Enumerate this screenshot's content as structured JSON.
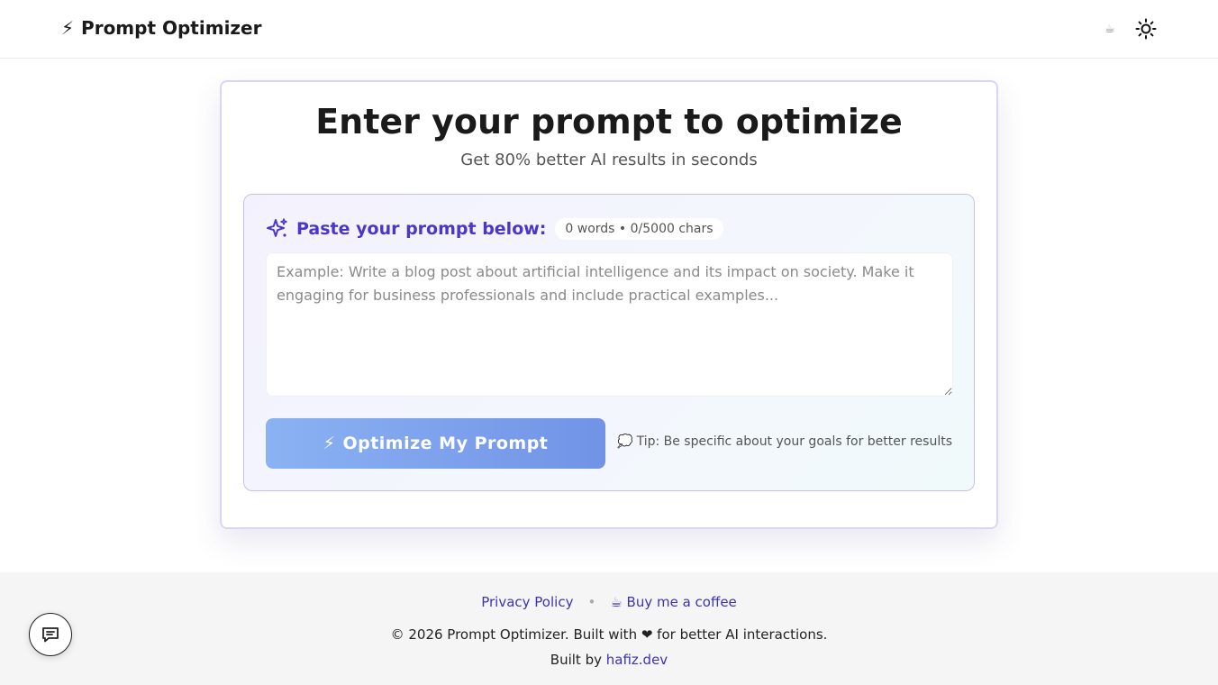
{
  "header": {
    "brand_icon": "⚡",
    "brand_name": "Prompt Optimizer",
    "coffee_icon": "☕",
    "theme_icon": "sun-icon"
  },
  "card": {
    "title": "Enter your prompt to optimize",
    "subtitle": "Get 80% better AI results in seconds",
    "panel_label": "Paste your prompt below:",
    "counter": "0 words • 0/5000 chars",
    "prompt_value": "",
    "prompt_placeholder": "Example: Write a blog post about artificial intelligence and its impact on society. Make it engaging for business professionals and include practical examples...",
    "optimize_icon": "⚡",
    "optimize_label": "Optimize My Prompt",
    "tip_icon": "💭",
    "tip_text": "Tip: Be specific about your goals for better results"
  },
  "footer": {
    "privacy_label": "Privacy Policy",
    "separator": "•",
    "coffee_icon": "☕",
    "coffee_label": "Buy me a coffee",
    "copyright": "© 2026 Prompt Optimizer. Built with ❤ for better AI interactions.",
    "built_by_prefix": "Built by",
    "built_by_link": "hafiz.dev"
  },
  "colors": {
    "accent": "#4a36c8",
    "link": "#3d33b5",
    "button_start": "#8bb2f3",
    "button_end": "#7193e6"
  }
}
